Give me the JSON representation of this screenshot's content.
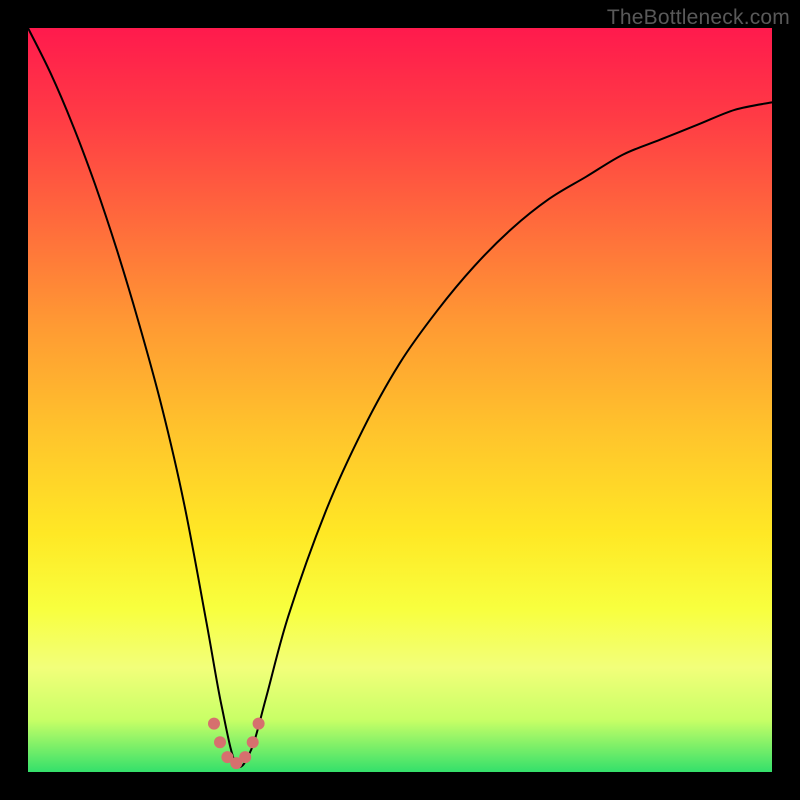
{
  "watermark": "TheBottleneck.com",
  "colors": {
    "frame": "#000000",
    "curve": "#000000",
    "marker": "#d6706e",
    "gradient_stops": [
      {
        "offset": 0.0,
        "color": "#ff1a4d"
      },
      {
        "offset": 0.12,
        "color": "#ff3b45"
      },
      {
        "offset": 0.26,
        "color": "#ff6a3c"
      },
      {
        "offset": 0.4,
        "color": "#ff9a33"
      },
      {
        "offset": 0.54,
        "color": "#ffc32c"
      },
      {
        "offset": 0.68,
        "color": "#ffe825"
      },
      {
        "offset": 0.78,
        "color": "#f8ff3e"
      },
      {
        "offset": 0.86,
        "color": "#f2ff7a"
      },
      {
        "offset": 0.93,
        "color": "#c8ff66"
      },
      {
        "offset": 1.0,
        "color": "#34e06b"
      }
    ]
  },
  "chart_data": {
    "type": "line",
    "title": "",
    "xlabel": "",
    "ylabel": "",
    "x_range": [
      0,
      100
    ],
    "y_range": [
      0,
      100
    ],
    "comment": "V-shaped bottleneck curve. Axis labels are not shown in the image; values are the approximate percentage height of the curve across a 0–100 horizontal domain, estimated from pixel position. Minimum (~0) occurs near x≈28.",
    "series": [
      {
        "name": "bottleneck-curve",
        "x": [
          0,
          3,
          6,
          9,
          12,
          15,
          18,
          21,
          24,
          26,
          28,
          30,
          32,
          35,
          40,
          45,
          50,
          55,
          60,
          65,
          70,
          75,
          80,
          85,
          90,
          95,
          100
        ],
        "values": [
          100,
          94,
          87,
          79,
          70,
          60,
          49,
          36,
          20,
          9,
          1,
          3,
          10,
          21,
          35,
          46,
          55,
          62,
          68,
          73,
          77,
          80,
          83,
          85,
          87,
          89,
          90
        ]
      }
    ],
    "markers": {
      "comment": "Cluster of salmon dots at the trough of the curve.",
      "points": [
        {
          "x": 25.0,
          "y": 6.5
        },
        {
          "x": 25.8,
          "y": 4.0
        },
        {
          "x": 26.8,
          "y": 2.0
        },
        {
          "x": 28.0,
          "y": 1.2
        },
        {
          "x": 29.2,
          "y": 2.0
        },
        {
          "x": 30.2,
          "y": 4.0
        },
        {
          "x": 31.0,
          "y": 6.5
        }
      ],
      "radius": 6
    }
  }
}
